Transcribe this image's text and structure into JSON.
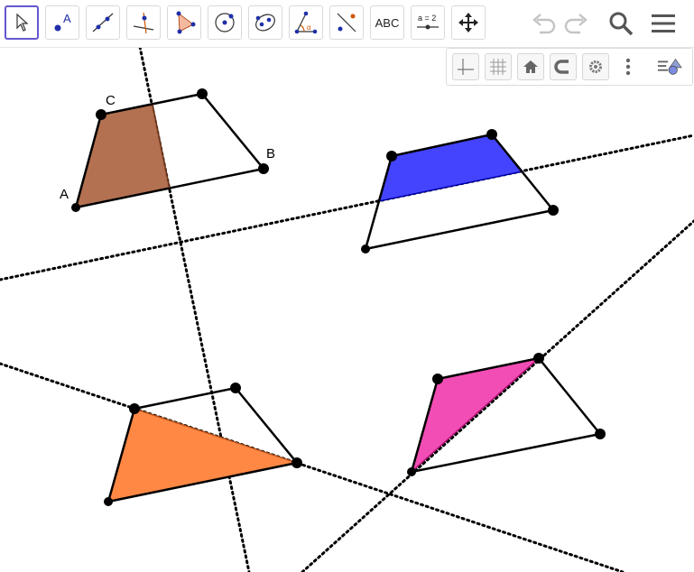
{
  "toolbar": {
    "tools": [
      {
        "name": "move-tool",
        "icon": "cursor-arrow-icon",
        "selected": true
      },
      {
        "name": "point-tool",
        "icon": "point-a-icon",
        "label": "A"
      },
      {
        "name": "line-tool",
        "icon": "line-through-points-icon"
      },
      {
        "name": "perpendicular-line-tool",
        "icon": "perpendicular-line-icon"
      },
      {
        "name": "polygon-tool",
        "icon": "polygon-icon"
      },
      {
        "name": "circle-tool",
        "icon": "circle-center-point-icon"
      },
      {
        "name": "conic-tool",
        "icon": "ellipse-icon"
      },
      {
        "name": "angle-tool",
        "icon": "angle-icon",
        "label": "α"
      },
      {
        "name": "reflect-tool",
        "icon": "reflect-about-line-icon"
      },
      {
        "name": "text-tool",
        "icon": "text-icon",
        "label": "ABC"
      },
      {
        "name": "slider-tool",
        "icon": "slider-icon",
        "label": "a = 2"
      },
      {
        "name": "move-graphics-tool",
        "icon": "move-graphics-view-icon"
      }
    ],
    "right": [
      "undo-icon",
      "redo-icon",
      "search-icon",
      "menu-icon"
    ]
  },
  "stylebar": {
    "buttons": [
      "axes-icon",
      "grid-icon",
      "standard-view-icon",
      "point-capturing-icon",
      "settings-icon",
      "more-vert-icon",
      "toggle-style-bar-icon"
    ]
  },
  "labels": {
    "A": "A",
    "B": "B",
    "C": "C"
  },
  "colors": {
    "accent": "#6557d2",
    "brown": "#a0522d",
    "blue": "#0000ff",
    "orange": "#ff7f2a",
    "pink": "#ff33aa"
  }
}
